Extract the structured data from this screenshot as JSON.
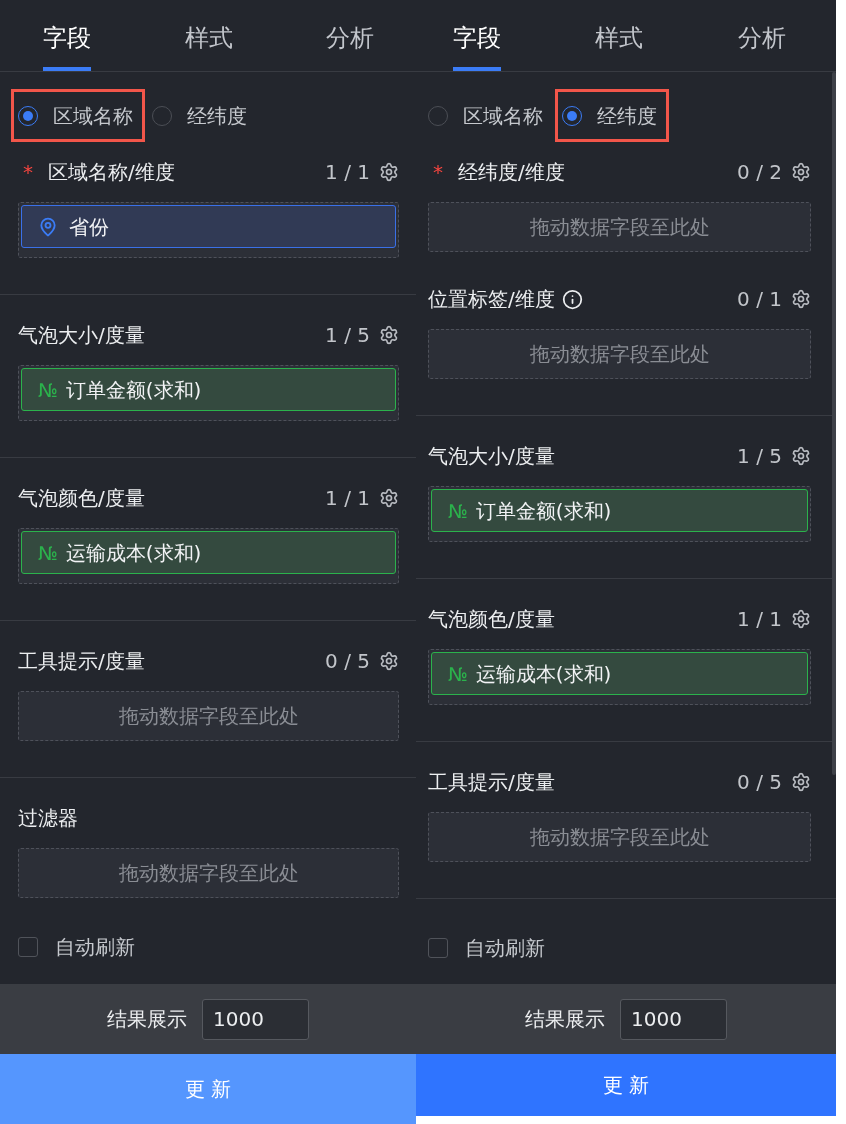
{
  "panels": [
    {
      "tabs": [
        {
          "label": "字段",
          "selected": true
        },
        {
          "label": "样式",
          "selected": false
        },
        {
          "label": "分析",
          "selected": false
        }
      ],
      "radio_options": [
        {
          "label": "区域名称",
          "selected": true,
          "highlighted": true
        },
        {
          "label": "经纬度",
          "selected": false,
          "highlighted": false
        }
      ],
      "sections": [
        {
          "kind": "wells",
          "wells": [
            {
              "required_mark": "*",
              "title": "区域名称/维度",
              "count": "1 / 1",
              "fields": [
                {
                  "kind": "dimension",
                  "label": "省份"
                }
              ]
            }
          ]
        },
        {
          "kind": "wells",
          "wells": [
            {
              "title": "气泡大小/度量",
              "count": "1 / 5",
              "fields": [
                {
                  "kind": "measure",
                  "symbol": "№",
                  "label": "订单金额(求和)"
                }
              ]
            }
          ]
        },
        {
          "kind": "wells",
          "wells": [
            {
              "title": "气泡颜色/度量",
              "count": "1 / 1",
              "fields": [
                {
                  "kind": "measure",
                  "symbol": "№",
                  "label": "运输成本(求和)"
                }
              ]
            }
          ]
        },
        {
          "kind": "wells",
          "wells": [
            {
              "title": "工具提示/度量",
              "count": "0 / 5",
              "placeholder": "拖动数据字段至此处"
            }
          ]
        },
        {
          "kind": "filter",
          "wells": [
            {
              "title": "过滤器",
              "placeholder": "拖动数据字段至此处"
            }
          ]
        }
      ],
      "auto_refresh": {
        "label": "自动刷新",
        "checked": false
      },
      "result_limit": {
        "label": "结果展示",
        "value": "1000"
      },
      "update_button": {
        "label": "更 新",
        "hover": true
      },
      "scrollbar": false
    },
    {
      "tabs": [
        {
          "label": "字段",
          "selected": true
        },
        {
          "label": "样式",
          "selected": false
        },
        {
          "label": "分析",
          "selected": false
        }
      ],
      "radio_options": [
        {
          "label": "区域名称",
          "selected": false,
          "highlighted": false
        },
        {
          "label": "经纬度",
          "selected": true,
          "highlighted": true
        }
      ],
      "sections": [
        {
          "kind": "wells",
          "wells": [
            {
              "required_mark": "*",
              "title": "经纬度/维度",
              "count": "0 / 2",
              "placeholder": "拖动数据字段至此处"
            },
            {
              "title": "位置标签/维度",
              "info_icon": true,
              "count": "0 / 1",
              "placeholder": "拖动数据字段至此处"
            }
          ]
        },
        {
          "kind": "wells",
          "wells": [
            {
              "title": "气泡大小/度量",
              "count": "1 / 5",
              "fields": [
                {
                  "kind": "measure",
                  "symbol": "№",
                  "label": "订单金额(求和)"
                }
              ]
            }
          ]
        },
        {
          "kind": "wells",
          "wells": [
            {
              "title": "气泡颜色/度量",
              "count": "1 / 1",
              "fields": [
                {
                  "kind": "measure",
                  "symbol": "№",
                  "label": "运输成本(求和)"
                }
              ]
            }
          ]
        },
        {
          "kind": "wells",
          "wells": [
            {
              "title": "工具提示/度量",
              "count": "0 / 5",
              "placeholder": "拖动数据字段至此处"
            }
          ]
        }
      ],
      "auto_refresh": {
        "label": "自动刷新",
        "checked": false
      },
      "result_limit": {
        "label": "结果展示",
        "value": "1000"
      },
      "update_button": {
        "label": "更 新",
        "hover": false
      },
      "scrollbar": true
    }
  ]
}
